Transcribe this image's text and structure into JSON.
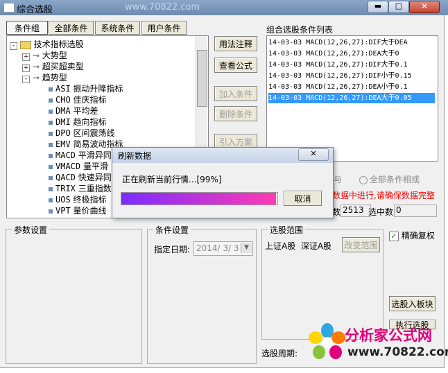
{
  "window": {
    "title": "综合选股",
    "controls": [
      "minimize",
      "maximize",
      "close"
    ],
    "watermark": "www.70822.com"
  },
  "tabs": [
    {
      "label": "条件组",
      "active": true
    },
    {
      "label": "全部条件",
      "active": false
    },
    {
      "label": "系统条件",
      "active": false
    },
    {
      "label": "用户条件",
      "active": false
    }
  ],
  "tree": {
    "root": "技术指标选股",
    "nodes": [
      {
        "label": "大势型",
        "kind": "branch",
        "expander": "+"
      },
      {
        "label": "超买超卖型",
        "kind": "branch",
        "expander": "+"
      },
      {
        "label": "趋势型",
        "kind": "branch",
        "expander": "-"
      },
      {
        "code": "ASI",
        "label": "振动升降指标"
      },
      {
        "code": "CHO",
        "label": "佳庆指标"
      },
      {
        "code": "DMA",
        "label": "平均差"
      },
      {
        "code": "DMI",
        "label": "趋向指标"
      },
      {
        "code": "DPO",
        "label": "区间震荡线"
      },
      {
        "code": "EMV",
        "label": "简易波动指标"
      },
      {
        "code": "MACD",
        "label": "平滑异同"
      },
      {
        "code": "VMACD",
        "label": "量平滑"
      },
      {
        "code": "QACD",
        "label": "快速异同"
      },
      {
        "code": "TRIX",
        "label": "三重指数"
      },
      {
        "code": "UOS",
        "label": "终极指标"
      },
      {
        "code": "VPT",
        "label": "量价曲线"
      }
    ]
  },
  "middle_buttons": [
    {
      "label": "用法注释",
      "enabled": true
    },
    {
      "label": "查看公式",
      "enabled": true
    },
    {
      "label": "加入条件",
      "enabled": false
    },
    {
      "label": "删除条件",
      "enabled": false
    },
    {
      "label": "引入方案",
      "enabled": false
    }
  ],
  "condition_list": {
    "title": "组合选股条件列表",
    "items": [
      "14-03-03 MACD(12,26,27):DIF大于DEA",
      "14-03-03 MACD(12,26,27):DEA大于0",
      "14-03-03 MACD(12,26,27):DIF大于0.1",
      "14-03-03 MACD(12,26,27):DIF小于0.15",
      "14-03-03 MACD(12,26,27):DEA小于0.1",
      "14-03-03 MACD(12,26,27):DEA大于0.05"
    ],
    "selected_index": 5
  },
  "logic": {
    "and_label": "与",
    "all_or_label": "全部条件相或"
  },
  "status": {
    "warning": "数据中进行,请确保数据完整",
    "total_prefix": "数",
    "total_value": "2513",
    "selected_label": "选中数",
    "selected_value": "0"
  },
  "param_group": {
    "title": "参数设置"
  },
  "cond_group": {
    "title": "条件设置",
    "date_label": "指定日期:",
    "date_value": "2014/ 3/ 3"
  },
  "range_group": {
    "title": "选股范围",
    "range_text": "上证A股  深证A股",
    "change_button": "改变范围"
  },
  "right_panel": {
    "exact_label": "精确复权",
    "exact_checked": true,
    "add_block_button": "选股入板块",
    "execute_button": "执行选股"
  },
  "period": {
    "label": "选股周期:"
  },
  "logo": {
    "text": "分析家公式网",
    "url": "www.70822.com"
  },
  "dialog": {
    "title": "刷新数据",
    "message": "正在刷新当前行情...[99%]",
    "progress_percent": 99,
    "cancel_button": "取消"
  },
  "colors": {
    "selection": "#3399ff",
    "warning": "#ff0000",
    "progress_start": "#7d2cff",
    "progress_end": "#ff3bb3",
    "logo_text": "#e0007a"
  }
}
